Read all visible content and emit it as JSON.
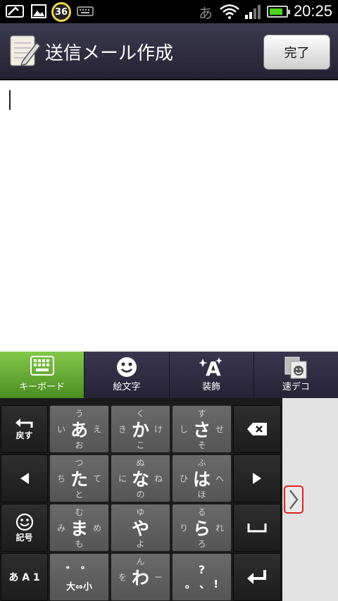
{
  "status_bar": {
    "notification_count": "36",
    "ime_indicator": "あ",
    "time": "20:25"
  },
  "header": {
    "title": "送信メール作成",
    "done_label": "完了"
  },
  "compose": {
    "body": ""
  },
  "tabs": [
    {
      "label": "キーボード",
      "icon": "keyboard-icon"
    },
    {
      "label": "絵文字",
      "icon": "smiley-icon"
    },
    {
      "label": "装飾",
      "icon": "decoration-icon"
    },
    {
      "label": "速デコ",
      "icon": "quick-deco-icon"
    }
  ],
  "keyboard": {
    "back_label": "戻す",
    "symbol_label": "記号",
    "mode_label": "あ A 1",
    "rows": [
      [
        {
          "main": "あ",
          "u": "う",
          "l": "い",
          "r": "え",
          "o": "お"
        },
        {
          "main": "か",
          "u": "く",
          "l": "き",
          "r": "け",
          "o": "こ"
        },
        {
          "main": "さ",
          "u": "す",
          "l": "し",
          "r": "せ",
          "o": "そ"
        }
      ],
      [
        {
          "main": "た",
          "u": "つ",
          "l": "ち",
          "r": "て",
          "o": "と"
        },
        {
          "main": "な",
          "u": "ぬ",
          "l": "に",
          "r": "ね",
          "o": "の"
        },
        {
          "main": "は",
          "u": "ふ",
          "l": "ひ",
          "r": "へ",
          "o": "ほ"
        }
      ],
      [
        {
          "main": "ま",
          "u": "む",
          "l": "み",
          "r": "め",
          "o": "も"
        },
        {
          "main": "や",
          "u": "ゆ",
          "l": "",
          "r": "",
          "o": "よ"
        },
        {
          "main": "ら",
          "u": "る",
          "l": "り",
          "r": "れ",
          "o": "ろ"
        }
      ]
    ],
    "bottom_row": {
      "dakuten_top": "゛ ゜",
      "dakuten_bottom": "大⇔小",
      "wa_main": "わ",
      "wa_u": "ん",
      "wa_l": "を",
      "wa_r": "ー",
      "punct_top": "?",
      "punct_bottom": "。 、 !"
    }
  },
  "colors": {
    "header_bg": "#2e2c3e",
    "active_tab": "#6cb23a",
    "expand_border": "#dd2222"
  }
}
